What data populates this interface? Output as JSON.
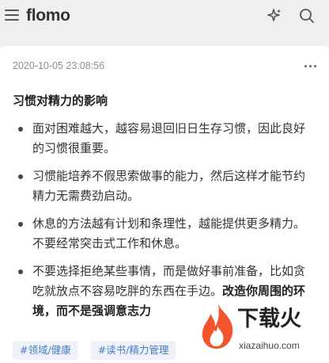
{
  "header": {
    "logo": "flomo",
    "menu_icon": "hamburger-menu-icon",
    "sparkle_icon": "sparkle-icon",
    "search_icon": "search-icon"
  },
  "memo": {
    "timestamp": "2020-10-05 23:08:56",
    "more_icon": "more-horizontal-icon",
    "title": "习惯对精力的影响",
    "items": [
      {
        "text": "面对困难越大，越容易退回旧日生存习惯，因此良好的习惯很重要。"
      },
      {
        "text": "习惯能培养不假思索做事的能力，然后这样才能节约精力无需费劲启动。"
      },
      {
        "text": "休息的方法越有计划和条理性，越能提供更多精力。不要经常突击式工作和休息。"
      },
      {
        "text": "不要选择拒绝某些事情，而是做好事前准备，比如贪吃就放点不容易吃胖的东西在手边。",
        "bold": "改造你周围的环境，而不是强调意志力"
      }
    ],
    "tags": [
      "#领域/健康",
      "#读书/精力管理"
    ]
  },
  "watermark": {
    "text": "下载火",
    "sub": "xiazaihuo.com"
  },
  "colors": {
    "background": "#efefef",
    "card": "#ffffff",
    "tag_bg": "#eef3f9",
    "tag_text": "#4a7bc1",
    "watermark_flame": "#f2552c"
  }
}
